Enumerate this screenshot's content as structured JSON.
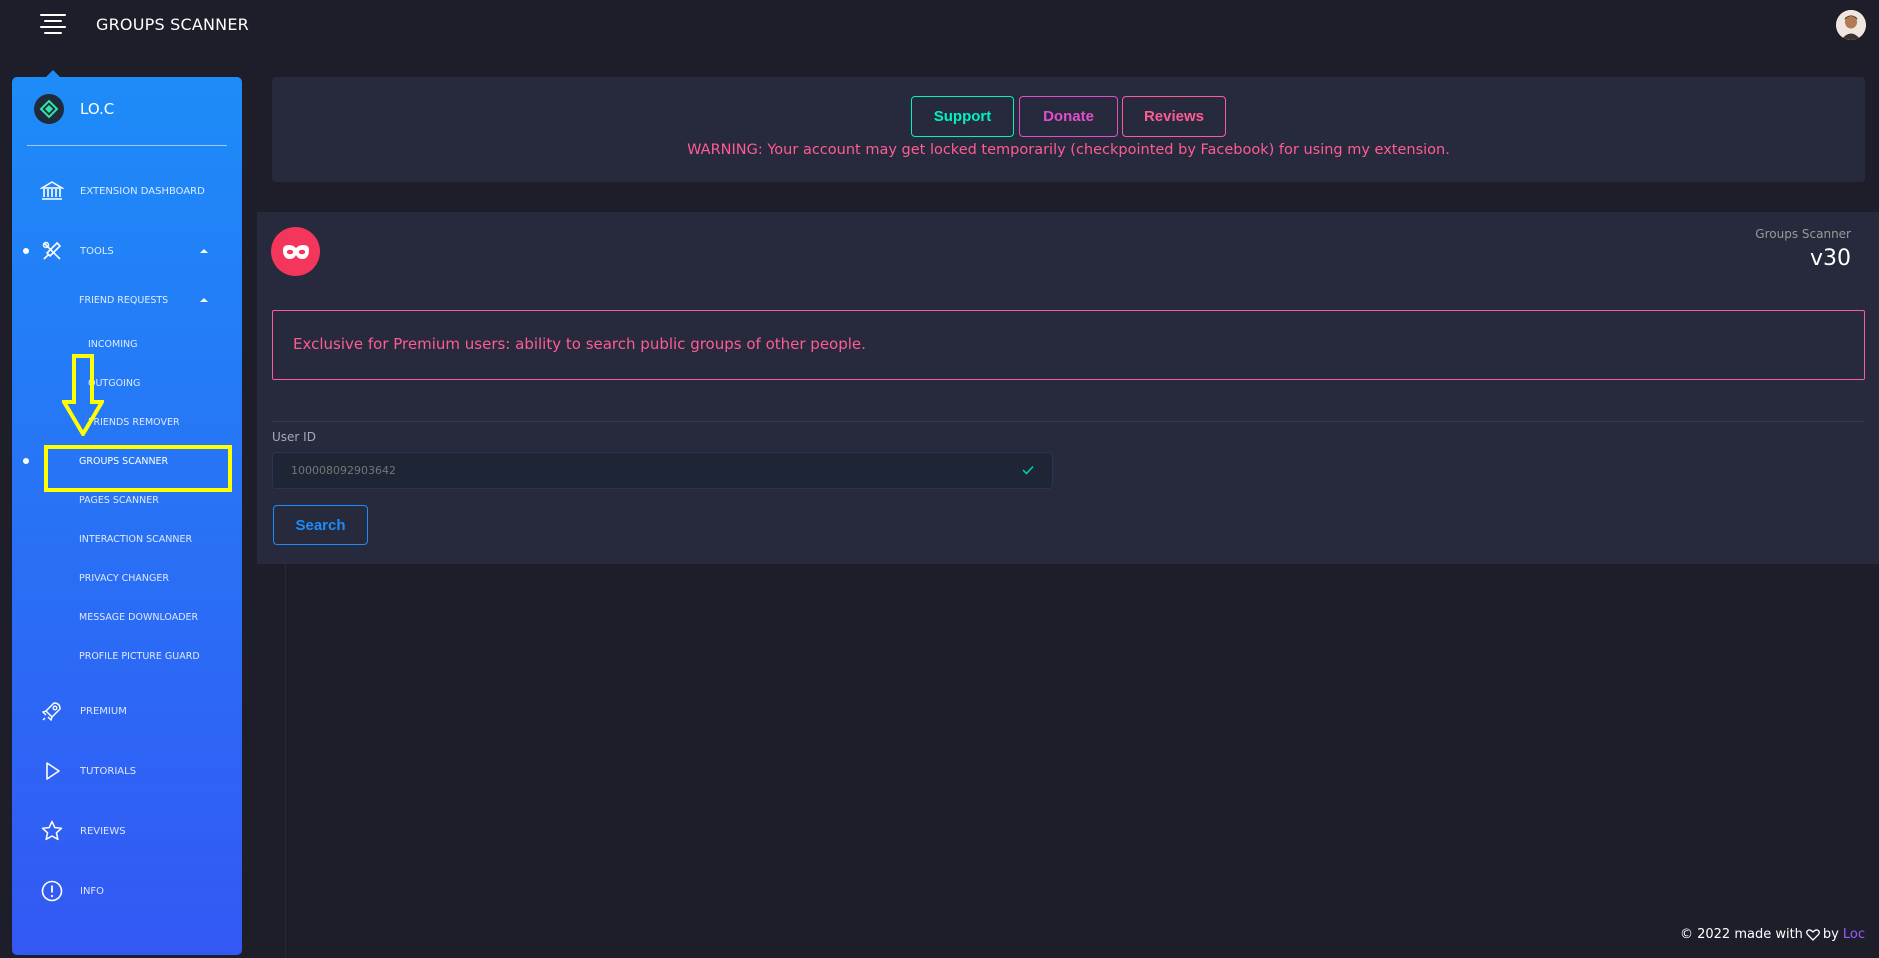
{
  "header": {
    "title": "GROUPS SCANNER"
  },
  "sidebar": {
    "brand": "LO.C",
    "items": {
      "dashboard": "EXTENSION DASHBOARD",
      "tools": "TOOLS",
      "friend_requests": "FRIEND REQUESTS",
      "incoming": "INCOMING",
      "outgoing": "OUTGOING",
      "friends_remover": "FRIENDS REMOVER",
      "groups_scanner": "GROUPS SCANNER",
      "pages_scanner": "PAGES SCANNER",
      "interaction_scanner": "INTERACTION SCANNER",
      "privacy_changer": "PRIVACY CHANGER",
      "message_downloader": "MESSAGE DOWNLOADER",
      "profile_picture_guard": "PROFILE PICTURE GUARD",
      "premium": "PREMIUM",
      "tutorials": "TUTORIALS",
      "reviews": "REVIEWS",
      "info": "INFO"
    }
  },
  "top_card": {
    "support_label": "Support",
    "donate_label": "Donate",
    "reviews_label": "Reviews",
    "warning": "WARNING: Your account may get locked temporarily (checkpointed by Facebook) for using my extension."
  },
  "scanner_card": {
    "subtitle": "Groups Scanner",
    "version": "v30",
    "premium_notice": "Exclusive for Premium users: ability to search public groups of other people.",
    "user_id_label": "User ID",
    "user_id_placeholder": "100008092903642",
    "search_label": "Search"
  },
  "footer": {
    "text": "© 2022 made with",
    "by": "by",
    "author": "Loc"
  },
  "colors": {
    "accent_blue": "#1d8cf8",
    "accent_pink": "#fd5d93",
    "accent_teal": "#00f2c3",
    "accent_magenta": "#e14eca",
    "highlight_yellow": "#ffff00"
  }
}
